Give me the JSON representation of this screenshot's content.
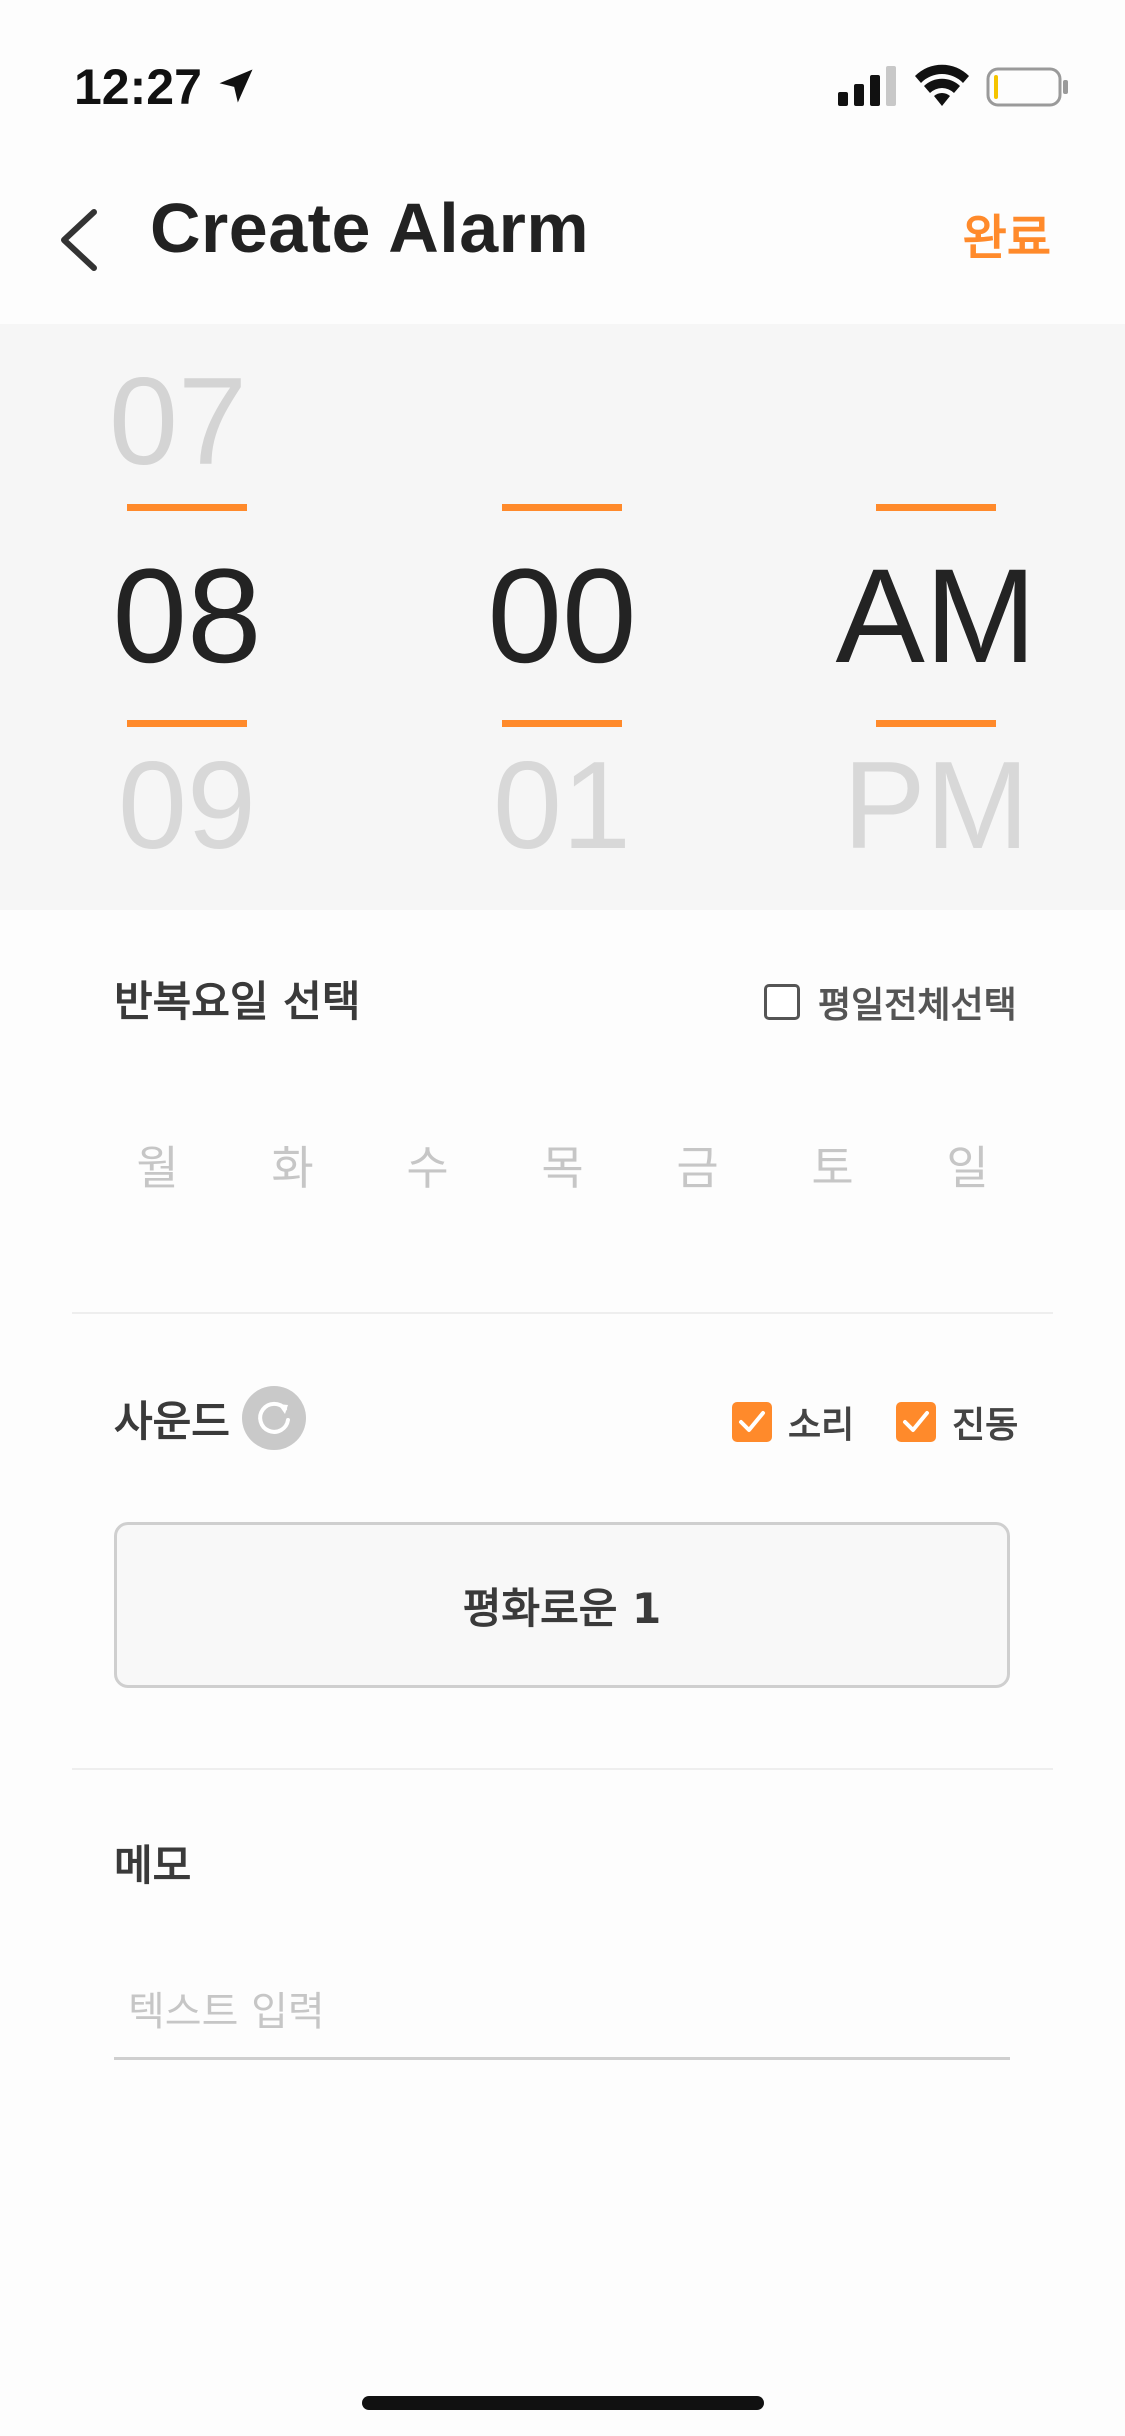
{
  "status_bar": {
    "time": "12:27",
    "battery_level": 0.05,
    "battery_color": "#f5c400"
  },
  "header": {
    "title": "Create Alarm",
    "done_label": "완료"
  },
  "picker": {
    "hour": {
      "prev": "07",
      "selected": "08",
      "next": "09"
    },
    "minute": {
      "prev": "",
      "selected": "00",
      "next": "01"
    },
    "period": {
      "prev": "",
      "selected": "AM",
      "next": "PM"
    },
    "accent_color": "#ff8a2b"
  },
  "repeat": {
    "label": "반복요일 선택",
    "weekdays_toggle_label": "평일전체선택",
    "weekdays_toggle_checked": false,
    "days": [
      "월",
      "화",
      "수",
      "목",
      "금",
      "토",
      "일"
    ]
  },
  "sound": {
    "label": "사운드",
    "refresh_icon": "refresh-icon",
    "sound_option_label": "소리",
    "sound_option_checked": true,
    "vibrate_option_label": "진동",
    "vibrate_option_checked": true,
    "selected_sound": "평화로운 1"
  },
  "memo": {
    "label": "메모",
    "placeholder": "텍스트 입력",
    "value": ""
  }
}
